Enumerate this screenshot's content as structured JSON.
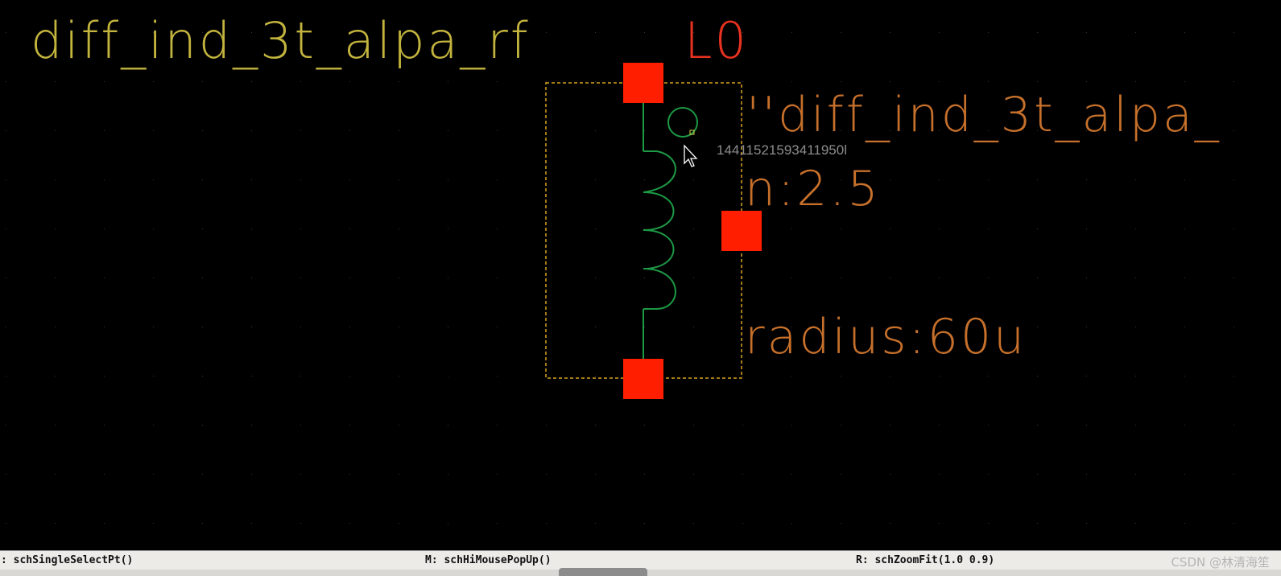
{
  "canvas": {
    "background": "#000000",
    "cell_name": "diff_ind_3t_alpa_rf",
    "instance_name": "L0",
    "model_label": "''diff_ind_3t_alpa_",
    "param_turns": "n:2.5",
    "param_radius": "radius:60u",
    "cursor_tooltip": "14411521593411950l",
    "colors": {
      "cell_name": "#c3b43e",
      "instance_name": "#e83220",
      "params": "#c6702b",
      "inductor": "#1c9a45",
      "pin": "#ff1f00",
      "selection_box": "#d8a21d",
      "tooltip": "#8c8c8c"
    },
    "icons": {
      "cursor": "arrow-pointer-icon",
      "inductor": "inductor-symbol-icon",
      "pin": "pin-square-icon"
    }
  },
  "status_bar": {
    "left": ": schSingleSelectPt()",
    "middle": "M: schHiMousePopUp()",
    "right": "R: schZoomFit(1.0 0.9)"
  },
  "watermark": "CSDN @林清海笙"
}
